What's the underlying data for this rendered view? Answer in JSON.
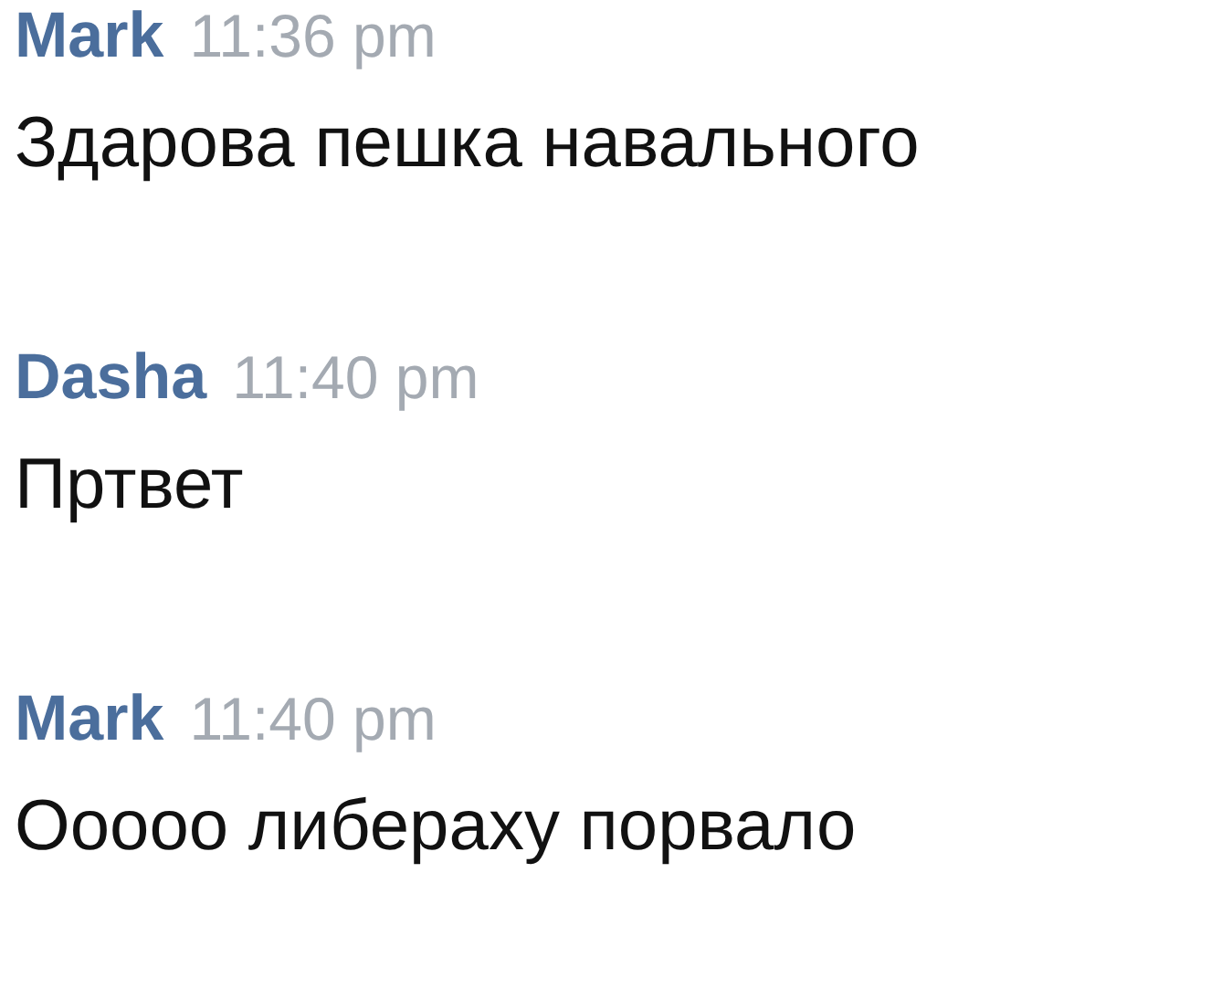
{
  "messages": [
    {
      "author": "Mark",
      "time": "11:36 pm",
      "text": "Здарова пешка навального"
    },
    {
      "author": "Dasha",
      "time": "11:40 pm",
      "text": "Пртвет"
    },
    {
      "author": "Mark",
      "time": "11:40 pm",
      "text": "Ооооо либераху порвало"
    }
  ]
}
